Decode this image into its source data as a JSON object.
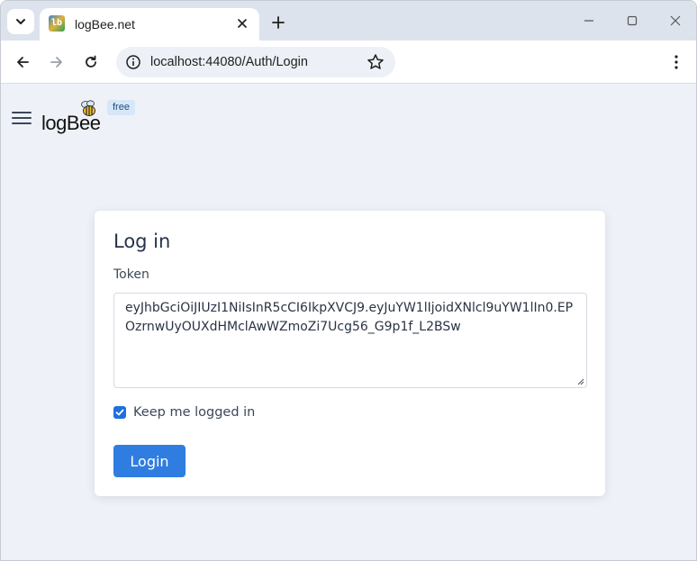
{
  "browser": {
    "tab_title": "logBee.net",
    "favicon_text": "lb",
    "url": "localhost:44080/Auth/Login",
    "icons": {
      "tab_search": "chevron-down-icon",
      "tab_close": "close-icon",
      "new_tab": "plus-icon",
      "minimize": "minimize-icon",
      "maximize": "maximize-icon",
      "close_window": "close-icon",
      "back": "arrow-left-icon",
      "forward": "arrow-right-icon",
      "reload": "reload-icon",
      "site_info": "info-icon",
      "bookmark": "star-icon",
      "menu": "kebab-menu-icon"
    }
  },
  "header": {
    "logo_text": "logBee",
    "badge": "free",
    "menu_icon": "hamburger-icon",
    "logo_icon": "bee-icon"
  },
  "login": {
    "title": "Log in",
    "token_label": "Token",
    "token_value": "eyJhbGciOiJIUzI1NiIsInR5cCI6IkpXVCJ9.eyJuYW1lIjoidXNlcl9uYW1lIn0.EPOzrnwUyOUXdHMclAwWZmoZi7Ucg56_G9p1f_L2BSw",
    "keep_logged_in_label": "Keep me logged in",
    "keep_logged_in_checked": true,
    "login_button": "Login"
  },
  "colors": {
    "accent": "#2f7de1",
    "page_bg": "#eef2f8",
    "tabstrip_bg": "#dde3ec"
  }
}
